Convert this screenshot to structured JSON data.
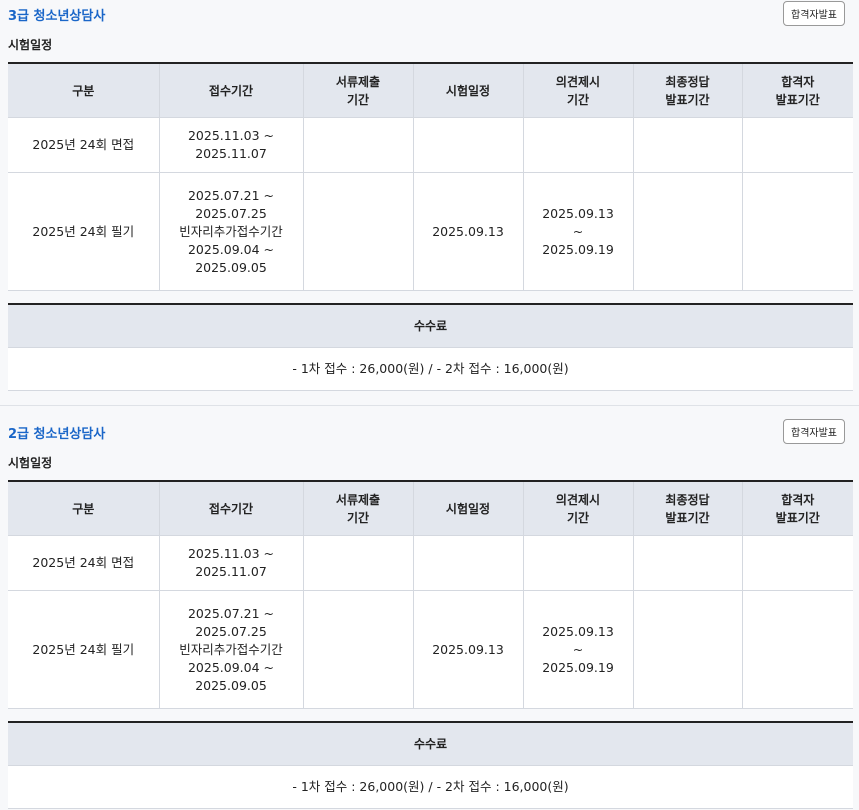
{
  "sections": [
    {
      "title": "3급 청소년상담사",
      "result_button": "합격자발표",
      "schedule_label": "시험일정",
      "headers": [
        [
          "구분"
        ],
        [
          "접수기간"
        ],
        [
          "서류제출",
          "기간"
        ],
        [
          "시험일정"
        ],
        [
          "의견제시",
          "기간"
        ],
        [
          "최종정답",
          "발표기간"
        ],
        [
          "합격자",
          "발표기간"
        ]
      ],
      "rows": [
        {
          "type": "2025년 24회 면접",
          "reception": [
            "2025.11.03 ~",
            "2025.11.07"
          ],
          "documents": "",
          "exam_date": "",
          "opinion": [],
          "final_answer": "",
          "pass": ""
        },
        {
          "type": "2025년 24회 필기",
          "reception": [
            "2025.07.21 ~",
            "2025.07.25",
            "빈자리추가접수기간",
            "2025.09.04 ~",
            "2025.09.05"
          ],
          "documents": "",
          "exam_date": "2025.09.13",
          "opinion": [
            "2025.09.13",
            "~",
            "2025.09.19"
          ],
          "final_answer": "",
          "pass": ""
        }
      ],
      "fee_header": "수수료",
      "fee_text": "- 1차 접수 : 26,000(원) / - 2차 접수 : 16,000(원)"
    },
    {
      "title": "2급 청소년상담사",
      "result_button": "합격자발표",
      "schedule_label": "시험일정",
      "headers": [
        [
          "구분"
        ],
        [
          "접수기간"
        ],
        [
          "서류제출",
          "기간"
        ],
        [
          "시험일정"
        ],
        [
          "의견제시",
          "기간"
        ],
        [
          "최종정답",
          "발표기간"
        ],
        [
          "합격자",
          "발표기간"
        ]
      ],
      "rows": [
        {
          "type": "2025년 24회 면접",
          "reception": [
            "2025.11.03 ~",
            "2025.11.07"
          ],
          "documents": "",
          "exam_date": "",
          "opinion": [],
          "final_answer": "",
          "pass": ""
        },
        {
          "type": "2025년 24회 필기",
          "reception": [
            "2025.07.21 ~",
            "2025.07.25",
            "빈자리추가접수기간",
            "2025.09.04 ~",
            "2025.09.05"
          ],
          "documents": "",
          "exam_date": "2025.09.13",
          "opinion": [
            "2025.09.13",
            "~",
            "2025.09.19"
          ],
          "final_answer": "",
          "pass": ""
        }
      ],
      "fee_header": "수수료",
      "fee_text": "- 1차 접수 : 26,000(원) / - 2차 접수 : 16,000(원)"
    }
  ]
}
